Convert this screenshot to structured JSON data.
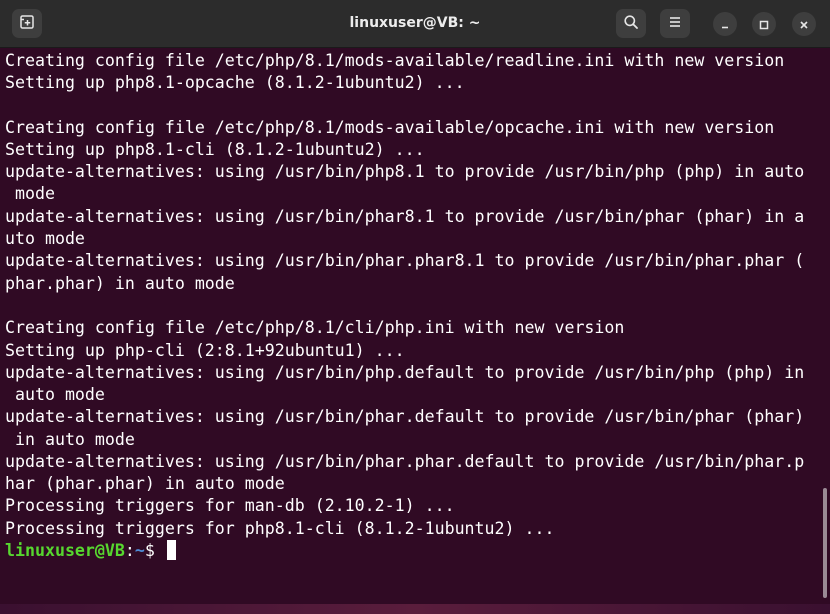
{
  "window": {
    "title": "linuxuser@VB: ~"
  },
  "titlebar": {
    "new_tab_icon": "new-tab-icon",
    "search_icon": "search-icon",
    "menu_icon": "hamburger-menu-icon",
    "minimize_icon": "minimize-icon",
    "maximize_icon": "maximize-icon",
    "close_icon": "close-icon"
  },
  "terminal": {
    "lines": [
      "Creating config file /etc/php/8.1/mods-available/readline.ini with new version",
      "Setting up php8.1-opcache (8.1.2-1ubuntu2) ...",
      "",
      "Creating config file /etc/php/8.1/mods-available/opcache.ini with new version",
      "Setting up php8.1-cli (8.1.2-1ubuntu2) ...",
      "update-alternatives: using /usr/bin/php8.1 to provide /usr/bin/php (php) in auto",
      " mode",
      "update-alternatives: using /usr/bin/phar8.1 to provide /usr/bin/phar (phar) in a",
      "uto mode",
      "update-alternatives: using /usr/bin/phar.phar8.1 to provide /usr/bin/phar.phar (",
      "phar.phar) in auto mode",
      "",
      "Creating config file /etc/php/8.1/cli/php.ini with new version",
      "Setting up php-cli (2:8.1+92ubuntu1) ...",
      "update-alternatives: using /usr/bin/php.default to provide /usr/bin/php (php) in",
      " auto mode",
      "update-alternatives: using /usr/bin/phar.default to provide /usr/bin/phar (phar)",
      " in auto mode",
      "update-alternatives: using /usr/bin/phar.phar.default to provide /usr/bin/phar.p",
      "har (phar.phar) in auto mode",
      "Processing triggers for man-db (2.10.2-1) ...",
      "Processing triggers for php8.1-cli (8.1.2-1ubuntu2) ..."
    ],
    "prompt": {
      "user_host": "linuxuser@VB",
      "separator": ":",
      "path": "~",
      "symbol": "$ "
    }
  },
  "colors": {
    "terminal_bg": "#300a24",
    "titlebar_bg": "#2c2c2c",
    "prompt_user": "#57d82f",
    "prompt_path": "#4e8bd6"
  }
}
